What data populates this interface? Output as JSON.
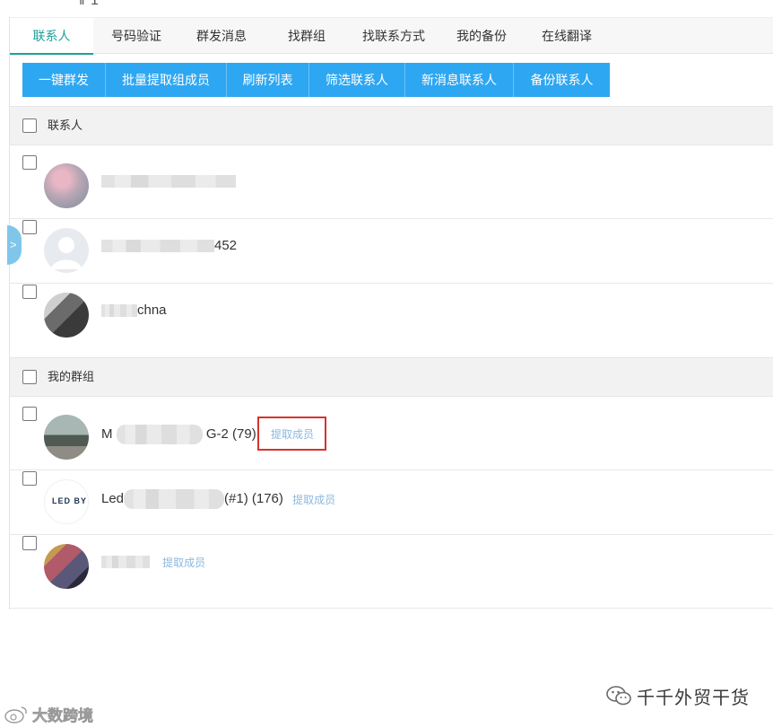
{
  "top_fragment": "‖ 1  ",
  "tabs": [
    "联系人",
    "号码验证",
    "群发消息",
    "找群组",
    "找联系方式",
    "我的备份",
    "在线翻译"
  ],
  "toolbar": [
    "一键群发",
    "批量提取组成员",
    "刷新列表",
    "筛选联系人",
    "新消息联系人",
    "备份联系人"
  ],
  "contacts_section": {
    "title": "联系人"
  },
  "contacts": [
    {
      "name_visible": ""
    },
    {
      "name_visible": "452"
    },
    {
      "name_visible": "chna"
    }
  ],
  "groups_section": {
    "title": "我的群组"
  },
  "groups": [
    {
      "name_prefix": "M",
      "name_suffix": "G-2 (79)",
      "extract_label": "提取成员"
    },
    {
      "name_prefix": "Led",
      "name_suffix": "(#1) (176)",
      "extract_label": "提取成员",
      "avatar_text": "LED BY"
    },
    {
      "name_prefix": "",
      "name_suffix": "",
      "extract_label": "提取成员"
    }
  ],
  "side_handle": ">",
  "watermark_right": "千千外贸干货",
  "watermark_left": "大数跨境",
  "colors": {
    "accent": "#1aa19a",
    "button": "#2ea7f2",
    "highlight_box": "#d8322d",
    "link": "#8cb8de"
  }
}
